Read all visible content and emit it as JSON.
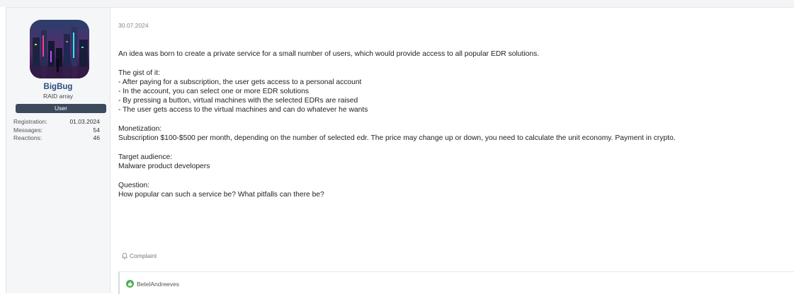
{
  "post": {
    "author": {
      "username": "BigBug",
      "title": "RAID array",
      "badge": "User",
      "stats": [
        {
          "label": "Registration:",
          "value": "01.03.2024"
        },
        {
          "label": "Messages:",
          "value": "54"
        },
        {
          "label": "Reactions:",
          "value": "46"
        }
      ]
    },
    "date": "30.07.2024",
    "paragraphs": [
      "An idea was born to create a private service for a small number of users, which would provide access to all popular EDR solutions.",
      "The gist of it:\n- After paying for a subscription, the user gets access to a personal account\n- In the account, you can select one or more EDR solutions\n- By pressing a button, virtual machines with the selected EDRs are raised\n- The user gets access to the virtual machines and can do whatever he wants",
      "Monetization:\nSubscription $100-$500 per month, depending on the number of selected edr. The price may change up or down, you need to calculate the unit economy. Payment in crypto.",
      "Target audience:\nMalware product developers",
      "Question:\nHow popular can such a service be? What pitfalls can there be?"
    ],
    "complaint_label": "Complaint",
    "reaction_user": "BetelAndreeves",
    "icons": {
      "complaint": "bell-icon",
      "reaction": "like-icon"
    }
  }
}
